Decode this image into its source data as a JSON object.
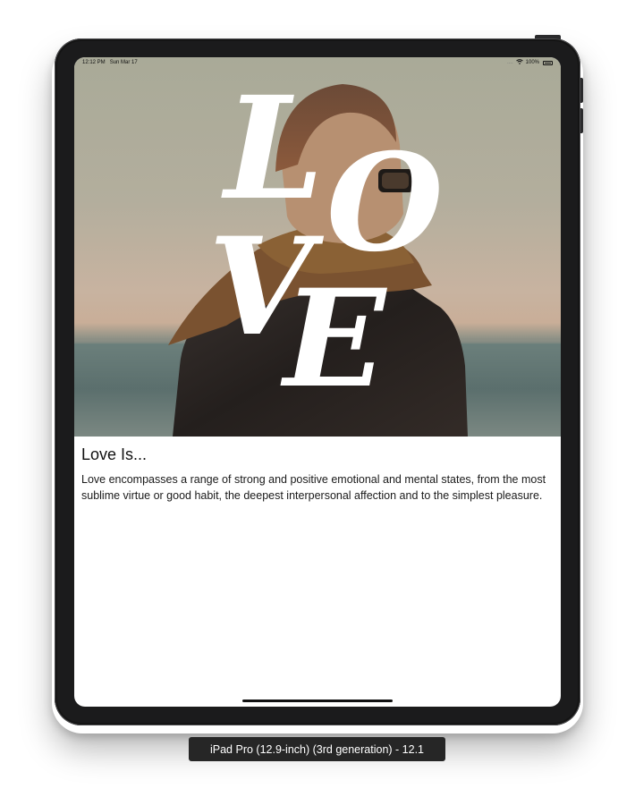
{
  "status_bar": {
    "time": "12:12 PM",
    "date": "Sun Mar 17",
    "signal": "....",
    "battery": "100%"
  },
  "hero": {
    "letters": [
      "L",
      "O",
      "V",
      "E"
    ]
  },
  "content": {
    "title": "Love Is...",
    "body": "Love encompasses a range of strong and positive emotional and mental states, from the most sublime virtue or good habit, the deepest interpersonal affection and to the simplest pleasure."
  },
  "simulator": {
    "device_label": "iPad Pro (12.9-inch) (3rd generation) - 12.1"
  },
  "icons": {
    "wifi": "wifi-icon",
    "battery": "battery-icon"
  }
}
